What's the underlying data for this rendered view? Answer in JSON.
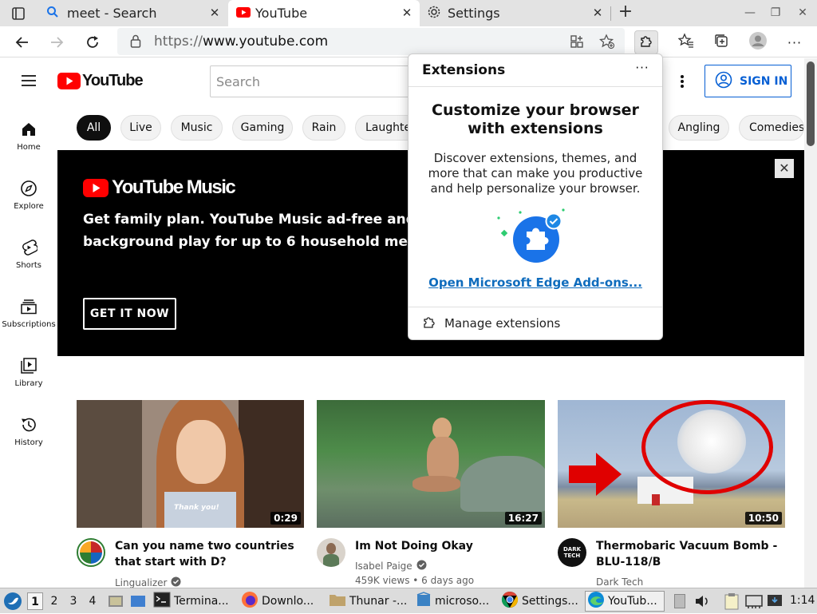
{
  "browser": {
    "tabs": [
      {
        "title": "meet - Search",
        "icon": "search-icon",
        "close": "✕"
      },
      {
        "title": "YouTube",
        "icon": "youtube-icon",
        "close": "✕"
      },
      {
        "title": "Settings",
        "icon": "gear-icon",
        "close": "✕"
      }
    ],
    "new_tab": "+",
    "window_controls": {
      "minimize": "—",
      "restore": "❐",
      "close": "✕"
    },
    "url_prefix": "https://",
    "url_host": "www.youtube.com"
  },
  "youtube": {
    "search_placeholder": "Search",
    "sign_in_label": "SIGN IN",
    "logo_text": "YouTube",
    "sidebar": [
      {
        "label": "Home",
        "icon": "home-icon"
      },
      {
        "label": "Explore",
        "icon": "compass-icon"
      },
      {
        "label": "Shorts",
        "icon": "shorts-icon"
      },
      {
        "label": "Subscriptions",
        "icon": "subscriptions-icon"
      },
      {
        "label": "Library",
        "icon": "library-icon"
      },
      {
        "label": "History",
        "icon": "history-icon"
      }
    ],
    "chips": [
      "All",
      "Live",
      "Music",
      "Gaming",
      "Rain",
      "Laughter",
      "Angling",
      "Comedies"
    ],
    "banner": {
      "logo_text": "YouTube Music",
      "headline_line1": "Get family plan. YouTube Music ad-free and",
      "headline_line2": "background play for up to 6 household members.",
      "cta": "GET IT NOW",
      "close": "✕"
    },
    "videos": [
      {
        "title": "Can you name two countries that start with D?",
        "channel": "Lingualizer",
        "verified": true,
        "duration": "0:29",
        "meta": "",
        "thumb_caption": "Thank you!"
      },
      {
        "title": "Im Not Doing Okay",
        "channel": "Isabel Paige",
        "verified": true,
        "duration": "16:27",
        "meta": "459K views • 6 days ago",
        "thumb_caption": ""
      },
      {
        "title": "Thermobaric Vacuum Bomb - BLU-118/B",
        "channel": "Dark Tech",
        "verified": false,
        "duration": "10:50",
        "meta": "",
        "avatar_text": "DARK TECH"
      }
    ]
  },
  "extensions_popup": {
    "header": "Extensions",
    "more": "···",
    "heading": "Customize your browser with extensions",
    "description": "Discover extensions, themes, and more that can make you productive and help personalize your browser.",
    "link": "Open Microsoft Edge Add-ons...",
    "manage": "Manage extensions"
  },
  "taskbar": {
    "workspaces": [
      "1",
      "2",
      "3",
      "4"
    ],
    "apps": [
      {
        "label": "Termina...",
        "icon": "terminal-icon"
      },
      {
        "label": "Downlo...",
        "icon": "firefox-icon"
      },
      {
        "label": "Thunar -...",
        "icon": "folder-icon"
      },
      {
        "label": "microso...",
        "icon": "package-icon"
      },
      {
        "label": "Settings...",
        "icon": "chrome-icon"
      },
      {
        "label": "YouTub...",
        "icon": "edge-icon"
      }
    ],
    "clock": "1:14"
  }
}
